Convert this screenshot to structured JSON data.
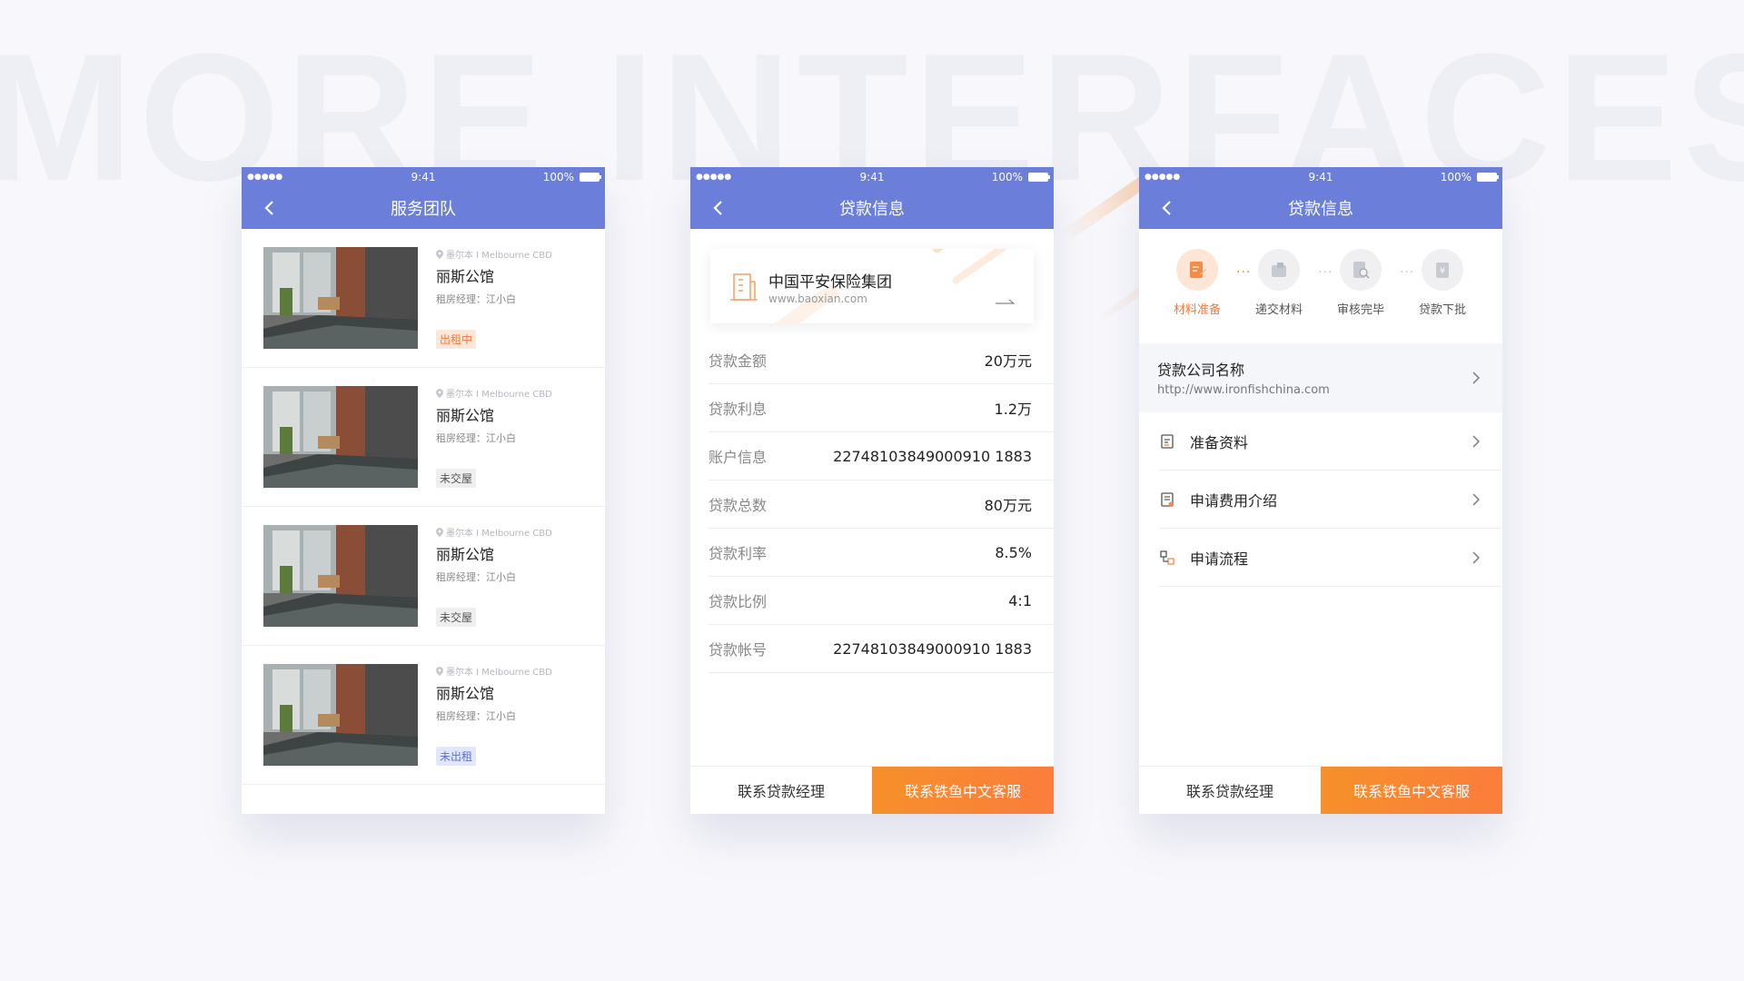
{
  "background_text": "MORE INTERFACES",
  "colors": {
    "brand": "#6b7fda",
    "accent": "#f6902a",
    "renting": "#f47a3a",
    "vacant": "#5b6fd6"
  },
  "status_bar": {
    "signal": "●●●●●",
    "time": "9:41",
    "battery": "100%"
  },
  "phone1": {
    "title": "服务团队",
    "items": [
      {
        "location": "墨尔本 I Melbourne CBD",
        "name": "丽斯公馆",
        "manager": "租房经理：江小白",
        "status": "出租中"
      },
      {
        "location": "墨尔本 I Melbourne CBD",
        "name": "丽斯公馆",
        "manager": "租房经理：江小白",
        "status": "未交屋"
      },
      {
        "location": "墨尔本 I Melbourne CBD",
        "name": "丽斯公馆",
        "manager": "租房经理：江小白",
        "status": "未交屋"
      },
      {
        "location": "墨尔本 I Melbourne CBD",
        "name": "丽斯公馆",
        "manager": "租房经理：江小白",
        "status": "未出租"
      }
    ]
  },
  "phone2": {
    "title": "贷款信息",
    "company": {
      "name": "中国平安保险集团",
      "url": "www.baoxian.com"
    },
    "rows": [
      {
        "label": "贷款金额",
        "value": "20万元"
      },
      {
        "label": "贷款利息",
        "value": "1.2万"
      },
      {
        "label": "账户信息",
        "value": "22748103849000910 1883"
      },
      {
        "label": "贷款总数",
        "value": "80万元"
      },
      {
        "label": "贷款利率",
        "value": "8.5%"
      },
      {
        "label": "贷款比例",
        "value": "4:1"
      },
      {
        "label": "贷款帐号",
        "value": "22748103849000910 1883"
      }
    ],
    "btn_left": "联系贷款经理",
    "btn_right": "联系铁鱼中文客服"
  },
  "phone3": {
    "title": "贷款信息",
    "steps": [
      "材料准备",
      "递交材料",
      "审核完毕",
      "贷款下批"
    ],
    "company_label": "贷款公司名称",
    "company_url": "http://www.ironfishchina.com",
    "menu": [
      "准备资料",
      "申请费用介绍",
      "申请流程"
    ],
    "btn_left": "联系贷款经理",
    "btn_right": "联系铁鱼中文客服"
  }
}
